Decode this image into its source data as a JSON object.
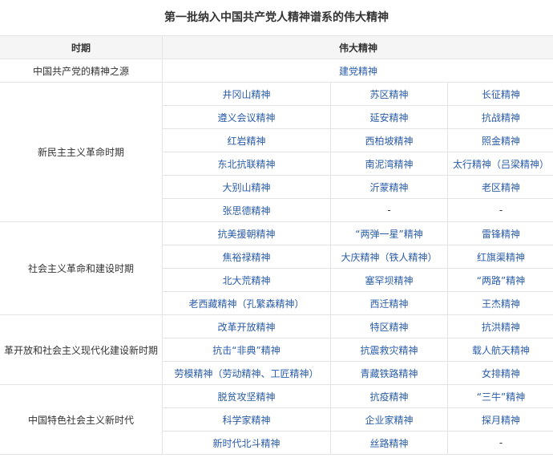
{
  "title": "第一批纳入中国共产党人精神谱系的伟大精神",
  "headers": {
    "period": "时期",
    "spirit": "伟大精神"
  },
  "colors": {
    "link": "#2a5ca8",
    "border": "#e4e4e4",
    "header_bg": "#f5f5f5"
  },
  "source": {
    "period": "中国共产党的精神之源",
    "spirit": "建党精神"
  },
  "periods": [
    {
      "name": "新民主主义革命时期",
      "rows": [
        [
          "井冈山精神",
          "苏区精神",
          "长征精神"
        ],
        [
          "遵义会议精神",
          "延安精神",
          "抗战精神"
        ],
        [
          "红岩精神",
          "西柏坡精神",
          "照金精神"
        ],
        [
          "东北抗联精神",
          "南泥湾精神",
          "太行精神（吕梁精神）"
        ],
        [
          "大别山精神",
          "沂蒙精神",
          "老区精神"
        ],
        [
          "张思德精神",
          "-",
          "-"
        ]
      ]
    },
    {
      "name": "社会主义革命和建设时期",
      "rows": [
        [
          "抗美援朝精神",
          "“两弹一星”精神",
          "雷锋精神"
        ],
        [
          "焦裕禄精神",
          "大庆精神（铁人精神）",
          "红旗渠精神"
        ],
        [
          "北大荒精神",
          "塞罕坝精神",
          "“两路”精神"
        ],
        [
          "老西藏精神（孔繁森精神）",
          "西迁精神",
          "王杰精神"
        ]
      ]
    },
    {
      "name": "革开放和社会主义现代化建设新时期",
      "rows": [
        [
          "改革开放精神",
          "特区精神",
          "抗洪精神"
        ],
        [
          "抗击“非典”精神",
          "抗震救灾精神",
          "载人航天精神"
        ],
        [
          "劳模精神（劳动精神、工匠精神）",
          "青藏铁路精神",
          "女排精神"
        ]
      ]
    },
    {
      "name": "中国特色社会主义新时代",
      "rows": [
        [
          "脱贫攻坚精神",
          "抗疫精神",
          "“三牛”精神"
        ],
        [
          "科学家精神",
          "企业家精神",
          "探月精神"
        ],
        [
          "新时代北斗精神",
          "丝路精神",
          "-"
        ]
      ]
    }
  ]
}
